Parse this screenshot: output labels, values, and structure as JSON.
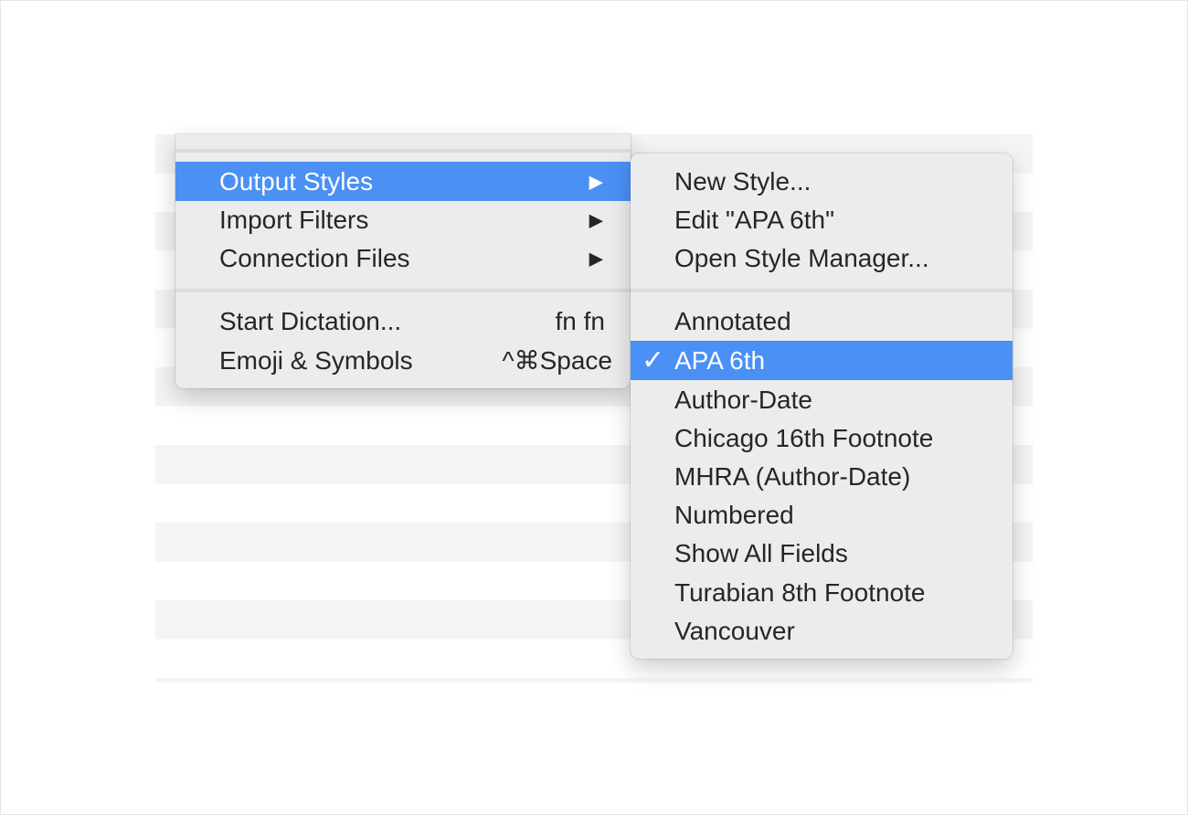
{
  "main_menu": {
    "items": [
      {
        "label": "Output Styles",
        "arrow": "▶",
        "highlighted": true
      },
      {
        "label": "Import Filters",
        "arrow": "▶"
      },
      {
        "label": "Connection Files",
        "arrow": "▶"
      },
      {
        "label": "Start Dictation...",
        "shortcut": "fn fn"
      },
      {
        "label": "Emoji & Symbols",
        "shortcut": "^⌘Space"
      }
    ]
  },
  "submenu": {
    "top_items": [
      {
        "label": "New Style..."
      },
      {
        "label": "Edit \"APA 6th\""
      },
      {
        "label": "Open Style Manager..."
      }
    ],
    "styles": [
      {
        "label": "Annotated"
      },
      {
        "label": "APA 6th",
        "checked": true,
        "check_mark": "✓"
      },
      {
        "label": "Author-Date"
      },
      {
        "label": "Chicago 16th Footnote"
      },
      {
        "label": "MHRA (Author-Date)"
      },
      {
        "label": "Numbered"
      },
      {
        "label": "Show All Fields"
      },
      {
        "label": "Turabian 8th Footnote"
      },
      {
        "label": "Vancouver"
      }
    ]
  },
  "colors": {
    "highlight": "#4a90f5",
    "menu_bg": "#ececec",
    "text": "#262626"
  }
}
